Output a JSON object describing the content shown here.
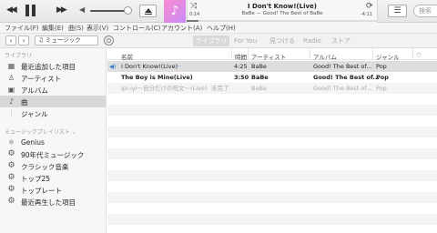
{
  "player": {
    "prev_icon": "◀◀",
    "next_icon": "▶▶",
    "vol_low_icon": "◀",
    "list_icon": "☰",
    "shuffle_icon": "⤨",
    "repeat_icon": "⟳",
    "progress_fraction": 0.06
  },
  "now_playing": {
    "title": "I Don't Know!(Live)",
    "subtitle": "BaBe — Good! The Best of BaBe",
    "elapsed": "0:14",
    "remaining": "-4:11",
    "artwork_icon": "♪"
  },
  "search": {
    "placeholder": "検索"
  },
  "menu": [
    "ファイル(F)",
    "編集(E)",
    "曲(S)",
    "表示(V)",
    "コントロール(C)",
    "アカウント(A)",
    "ヘルプ(H)"
  ],
  "toolbar": {
    "back": "‹",
    "forward": "›",
    "library_selector": "♫ ミュージック",
    "tabs": [
      "ライブラリ",
      "For You",
      "見つける",
      "Radio",
      "ストア"
    ]
  },
  "sidebar": {
    "library_heading": "ライブラリ",
    "library_items": [
      {
        "label": "最近追加した項目",
        "icon": "▦"
      },
      {
        "label": "アーティスト",
        "icon": "♙"
      },
      {
        "label": "アルバム",
        "icon": "▣"
      },
      {
        "label": "曲",
        "icon": "♪"
      },
      {
        "label": "ジャンル",
        "icon": "⫶"
      }
    ],
    "playlists_heading": "ミュージックプレイリスト ⌄",
    "playlist_items": [
      {
        "label": "Genius",
        "icon": "⚛"
      },
      {
        "label": "90年代ミュージック",
        "icon": "⚙"
      },
      {
        "label": "クラシック音楽",
        "icon": "⚙"
      },
      {
        "label": "トップ25",
        "icon": "⚙"
      },
      {
        "label": "トップレート",
        "icon": "⚙"
      },
      {
        "label": "最近再生した項目",
        "icon": "⚙"
      }
    ]
  },
  "table": {
    "columns": {
      "name": "名前",
      "time": "時間",
      "artist": "アーティスト",
      "album": "アルバム",
      "genre": "ジャンル",
      "love": "♡"
    },
    "rows": [
      {
        "name": "I Don't Know!(Live)",
        "time": "4:25",
        "artist": "BaBe",
        "album": "Good! The Best of...",
        "genre": "Pop",
        "status": ""
      },
      {
        "name": "The Boy is Mine(Live)",
        "time": "3:50",
        "artist": "BaBe",
        "album": "Good! The Best of...",
        "genre": "Pop",
        "status": ""
      },
      {
        "name": "ipi-iyi〜自分だけの呪文〜(Live)",
        "time": "",
        "artist": "BaBe",
        "album": "Good! The Best of...",
        "genre": "Pop",
        "status": "未完了"
      }
    ],
    "playing_icon": "◀)",
    "more_icon": "···"
  }
}
